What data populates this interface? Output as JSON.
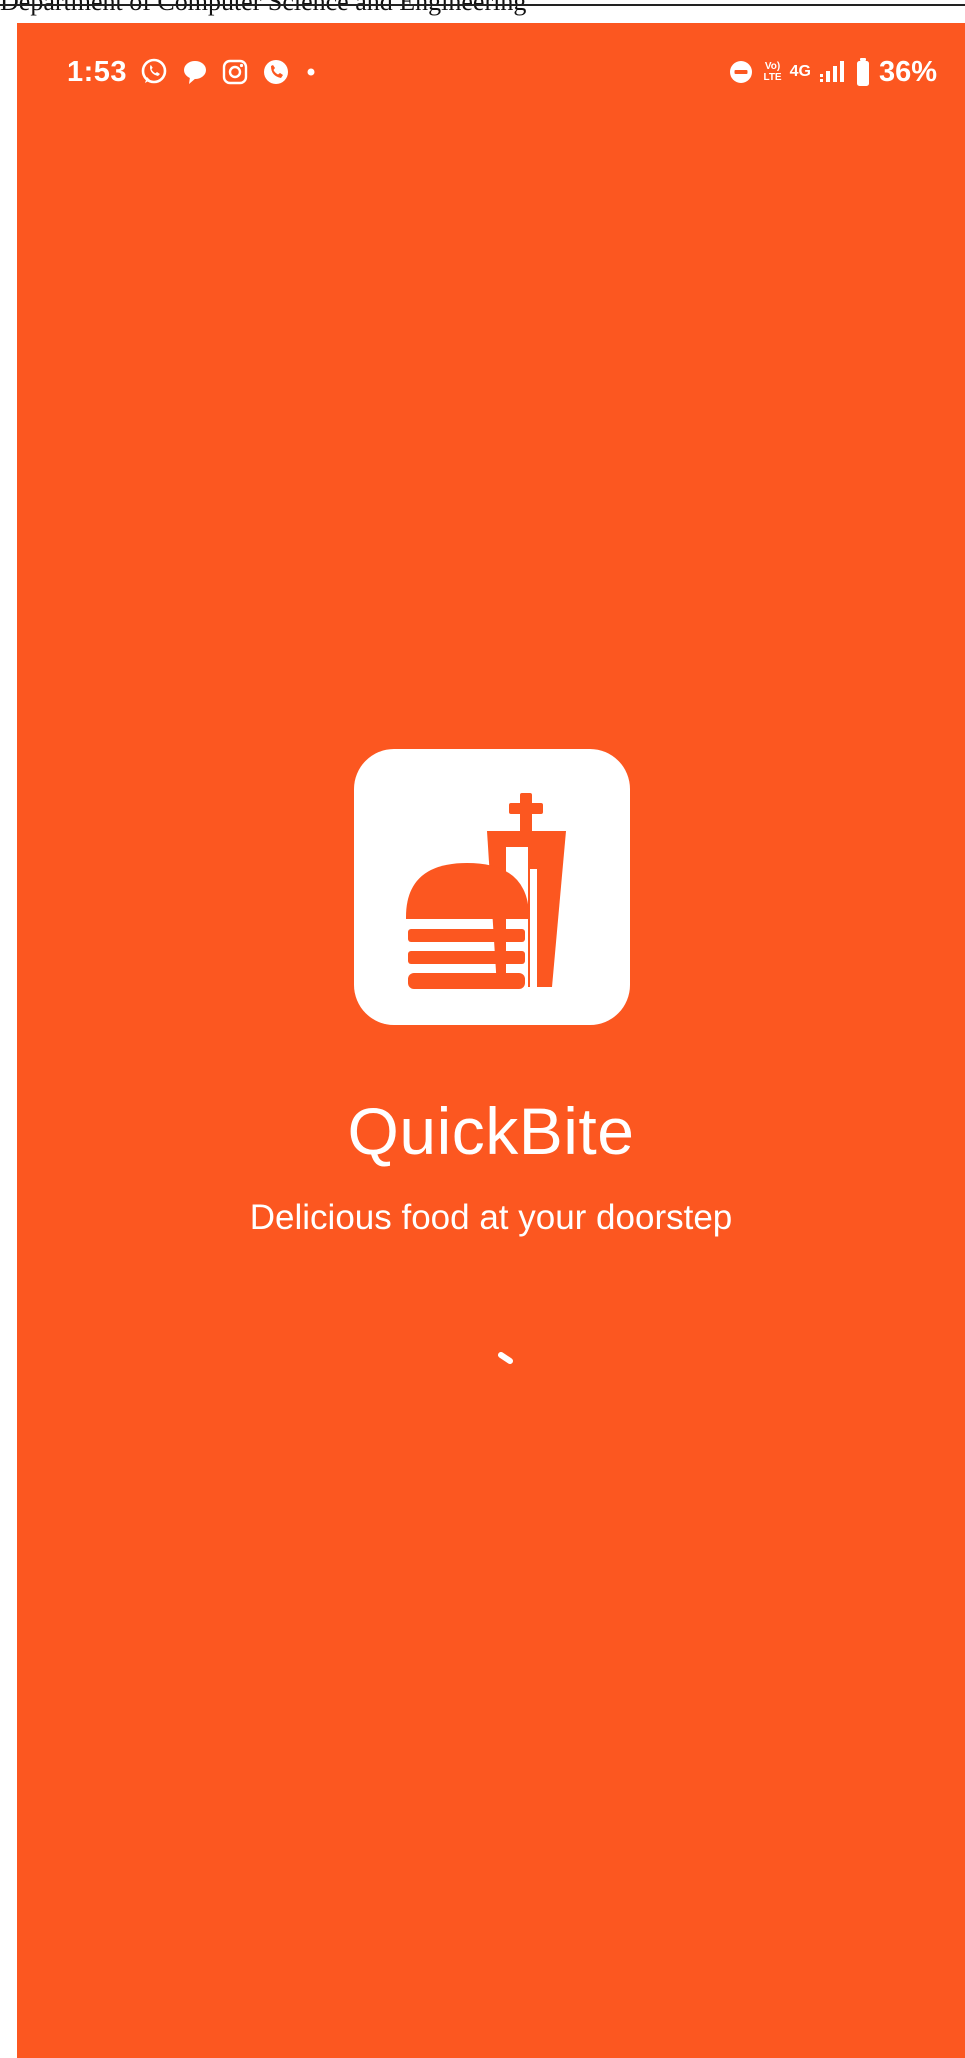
{
  "document": {
    "header_text": "Department of Computer Science and Engineering"
  },
  "status_bar": {
    "time": "1:53",
    "left_icons": [
      "whatsapp-icon",
      "chat-bubble-icon",
      "instagram-icon",
      "phone-call-app-icon",
      "dot-icon"
    ],
    "right_icons": [
      "do-not-disturb-icon",
      "volte-icon",
      "signal-icon",
      "battery-icon"
    ],
    "volte_top": "Vo)",
    "volte_bottom": "LTE",
    "network": "4G",
    "battery": "36%"
  },
  "splash": {
    "app_name": "QuickBite",
    "tagline": "Delicious food at your doorstep",
    "logo_icon": "burger-and-drink-icon",
    "loading_indicator": "spinner-icon"
  },
  "colors": {
    "background": "#fc5720",
    "logo_tile": "#ffffff",
    "text": "#ffffff"
  }
}
